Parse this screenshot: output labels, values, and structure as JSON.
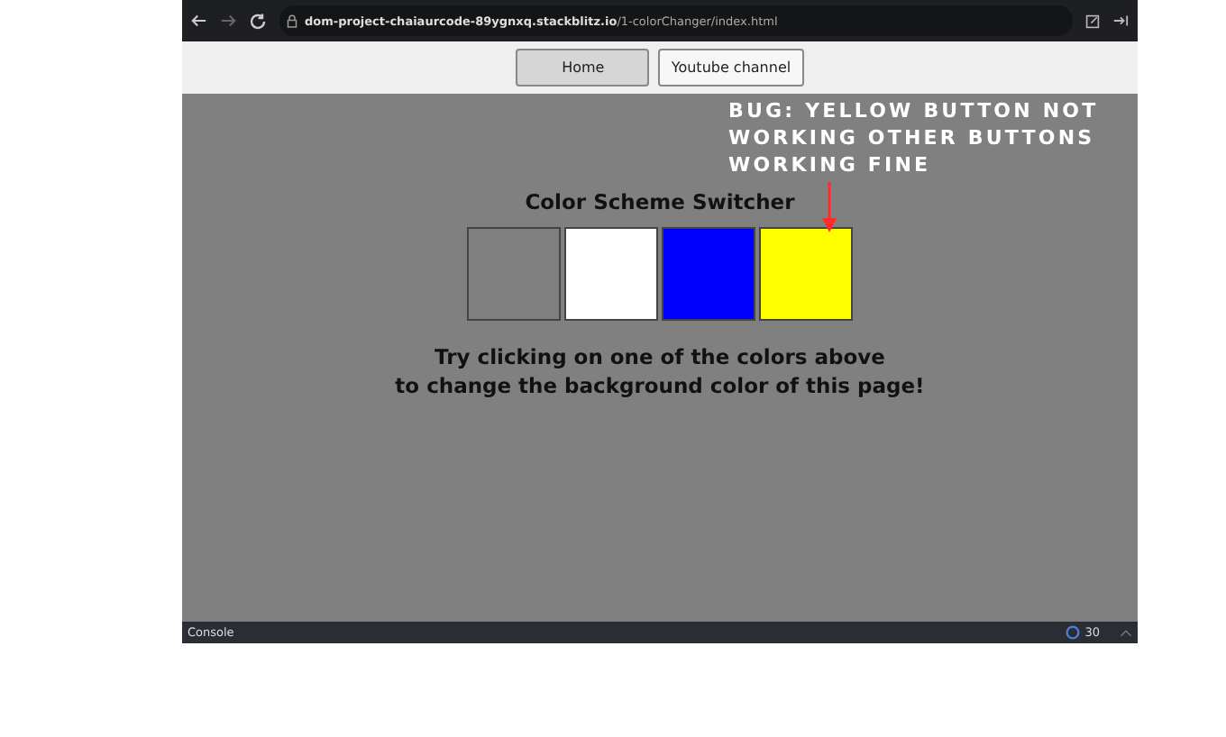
{
  "browser": {
    "url_host": "dom-project-chaiaurcode-89ygnxq.stackblitz.io",
    "url_path": "/1-colorChanger/index.html"
  },
  "nav": [
    {
      "label": "Home",
      "selected": true
    },
    {
      "label": "Youtube channel",
      "selected": false
    }
  ],
  "annotation": {
    "text": "BUG: YELLOW BUTTON NOT WORKING OTHER BUTTONS WORKING FINE"
  },
  "heading": "Color Scheme Switcher",
  "swatches": [
    {
      "color": "#808080"
    },
    {
      "color": "#ffffff"
    },
    {
      "color": "#0000ff"
    },
    {
      "color": "#ffff00"
    }
  ],
  "instructions": [
    "Try clicking on one of the colors above",
    "to change the background color of this page!"
  ],
  "console": {
    "label": "Console",
    "count": "30"
  }
}
